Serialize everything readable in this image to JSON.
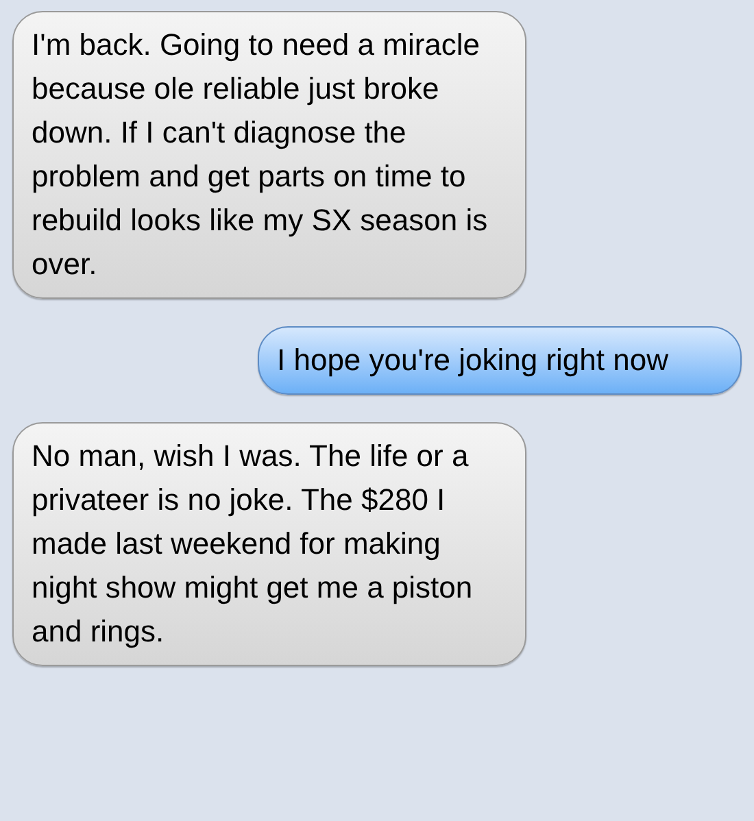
{
  "messages": [
    {
      "kind": "received",
      "text": "I'm back. Going to need a miracle because ole reliable just broke down. If I can't diagnose the problem and get parts on time to rebuild looks like my SX season is over."
    },
    {
      "kind": "sent",
      "text": "I hope you're joking right now"
    },
    {
      "kind": "received",
      "text": "No man, wish I was. The life or a privateer is no joke. The $280 I made last weekend for making night show might get me a piston and rings."
    }
  ]
}
